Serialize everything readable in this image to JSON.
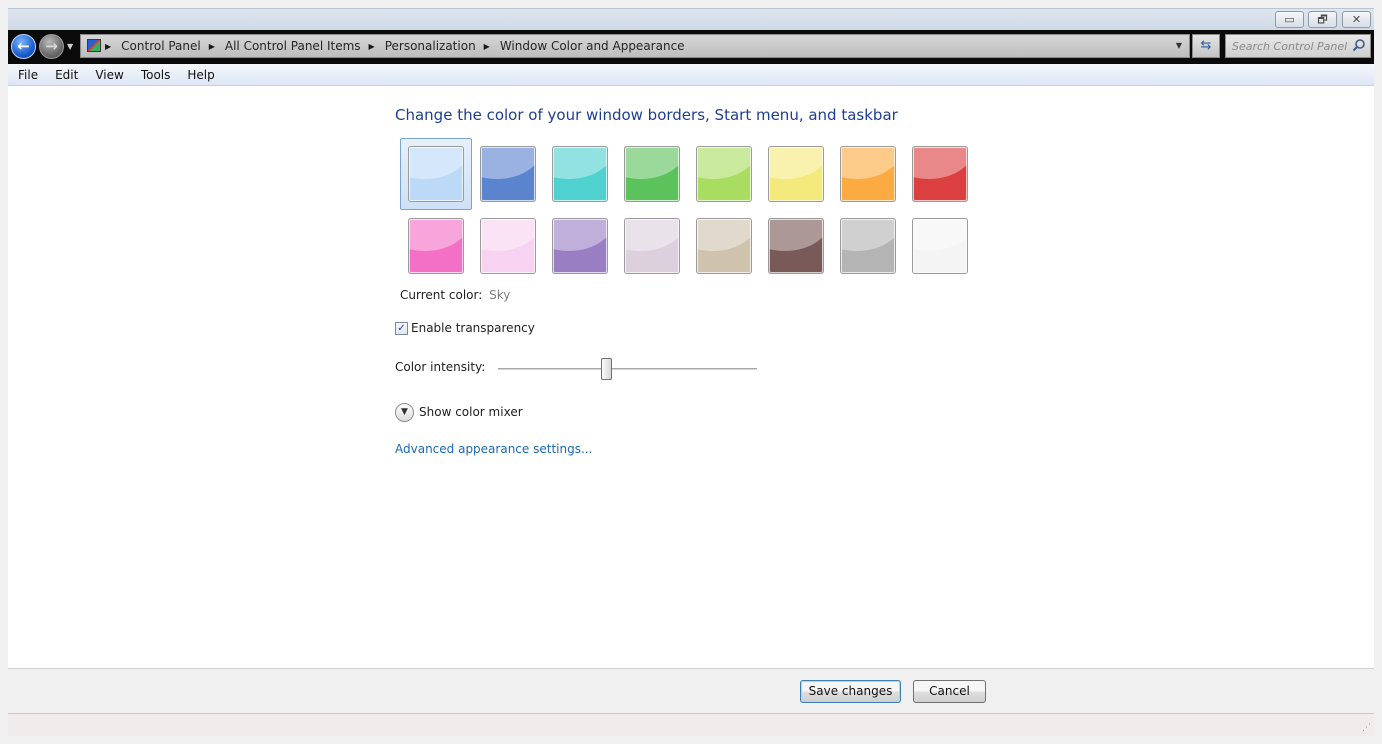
{
  "window": {
    "caption_buttons": {
      "minimize": "▭",
      "restore": "🗗",
      "close": "✕"
    }
  },
  "address_bar": {
    "breadcrumb": [
      "Control Panel",
      "All Control Panel Items",
      "Personalization",
      "Window Color and Appearance"
    ],
    "search_placeholder": "Search Control Panel"
  },
  "menu": [
    "File",
    "Edit",
    "View",
    "Tools",
    "Help"
  ],
  "main": {
    "heading": "Change the color of your window borders, Start menu, and taskbar",
    "swatches": [
      {
        "color": "#bcd9f7",
        "selected": true
      },
      {
        "color": "#5b84cf",
        "selected": false
      },
      {
        "color": "#4fd1cf",
        "selected": false
      },
      {
        "color": "#5cc25c",
        "selected": false
      },
      {
        "color": "#a9dd62",
        "selected": false
      },
      {
        "color": "#f4ea7c",
        "selected": false
      },
      {
        "color": "#fbab42",
        "selected": false
      },
      {
        "color": "#db3f3f",
        "selected": false
      },
      {
        "color": "#f46fc6",
        "selected": false
      },
      {
        "color": "#f8d2f1",
        "selected": false
      },
      {
        "color": "#9a7ec4",
        "selected": false
      },
      {
        "color": "#ddd0dd",
        "selected": false
      },
      {
        "color": "#cfc3ad",
        "selected": false
      },
      {
        "color": "#7a5a58",
        "selected": false
      },
      {
        "color": "#b4b4b4",
        "selected": false
      },
      {
        "color": "#f4f4f4",
        "selected": false
      }
    ],
    "current_color_label": "Current color:",
    "current_color_value": "Sky",
    "transparency_label": "Enable transparency",
    "transparency_checked": true,
    "intensity_label": "Color intensity:",
    "intensity_level": 0.42,
    "mixer_label": "Show color mixer",
    "advanced_link": "Advanced appearance settings..."
  },
  "footer": {
    "save_label": "Save changes",
    "cancel_label": "Cancel"
  },
  "colors": {
    "heading": "#1e3f8f",
    "link": "#1b68b4"
  }
}
